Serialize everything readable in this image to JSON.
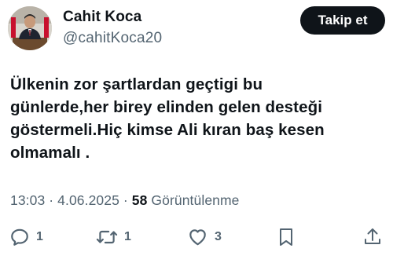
{
  "author": {
    "display_name": "Cahit Koca",
    "handle": "@cahitKoca20"
  },
  "follow_button_label": "Takip et",
  "tweet_lines": [
    "Ülkenin zor şartlardan geçtigi bu",
    "günlerde,her birey elinden gelen desteği",
    "göstermeli.Hiç kimse Ali kıran baş kesen",
    "olmamalı ."
  ],
  "meta": {
    "time": "13:03",
    "separator": " · ",
    "date": "4.06.2025",
    "views_count": "58",
    "views_label": "Görüntülenme"
  },
  "actions": {
    "reply_count": "1",
    "retweet_count": "1",
    "like_count": "3"
  },
  "icons": {
    "reply": "reply-icon",
    "retweet": "retweet-icon",
    "like": "heart-icon",
    "bookmark": "bookmark-icon",
    "share": "share-icon"
  },
  "colors": {
    "text_primary": "#0f1419",
    "text_secondary": "#536471",
    "follow_button_bg": "#0f1419"
  }
}
